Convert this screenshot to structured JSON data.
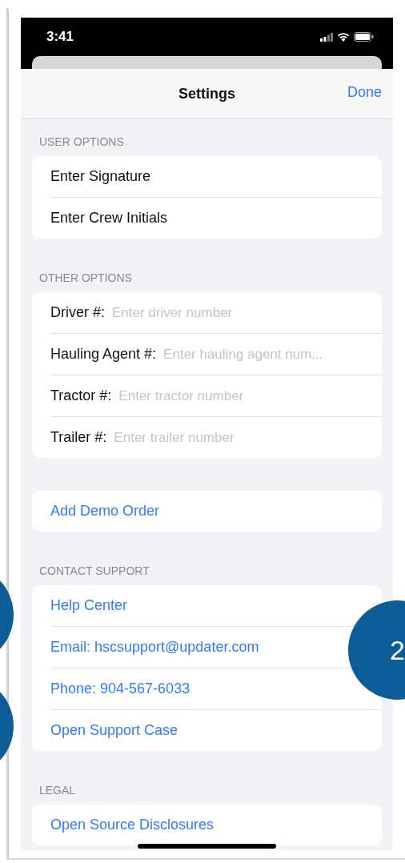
{
  "status_bar": {
    "time": "3:41"
  },
  "nav_bar": {
    "title": "Settings",
    "done": "Done"
  },
  "sections": [
    {
      "header": "USER OPTIONS",
      "rows": [
        {
          "kind": "action",
          "label": "Enter Signature"
        },
        {
          "kind": "action",
          "label": "Enter Crew Initials"
        }
      ]
    },
    {
      "header": "OTHER OPTIONS",
      "rows": [
        {
          "kind": "field",
          "label": "Driver #:",
          "placeholder": "Enter driver number"
        },
        {
          "kind": "field",
          "label": "Hauling Agent #:",
          "placeholder": "Enter hauling agent num..."
        },
        {
          "kind": "field",
          "label": "Tractor #:",
          "placeholder": "Enter tractor number"
        },
        {
          "kind": "field",
          "label": "Trailer #:",
          "placeholder": "Enter trailer number"
        }
      ]
    },
    {
      "rows": [
        {
          "kind": "link",
          "label": "Add Demo Order"
        }
      ]
    },
    {
      "header": "CONTACT SUPPORT",
      "rows": [
        {
          "kind": "link",
          "label": "Help Center"
        },
        {
          "kind": "link",
          "label": "Email: hscsupport@updater.com"
        },
        {
          "kind": "link",
          "label": "Phone: 904-567-6033"
        },
        {
          "kind": "link",
          "label": "Open Support Case"
        }
      ]
    },
    {
      "header": "LEGAL",
      "rows": [
        {
          "kind": "link",
          "label": "Open Source Disclosures"
        }
      ]
    }
  ],
  "callouts": [
    {
      "label": "2"
    }
  ]
}
